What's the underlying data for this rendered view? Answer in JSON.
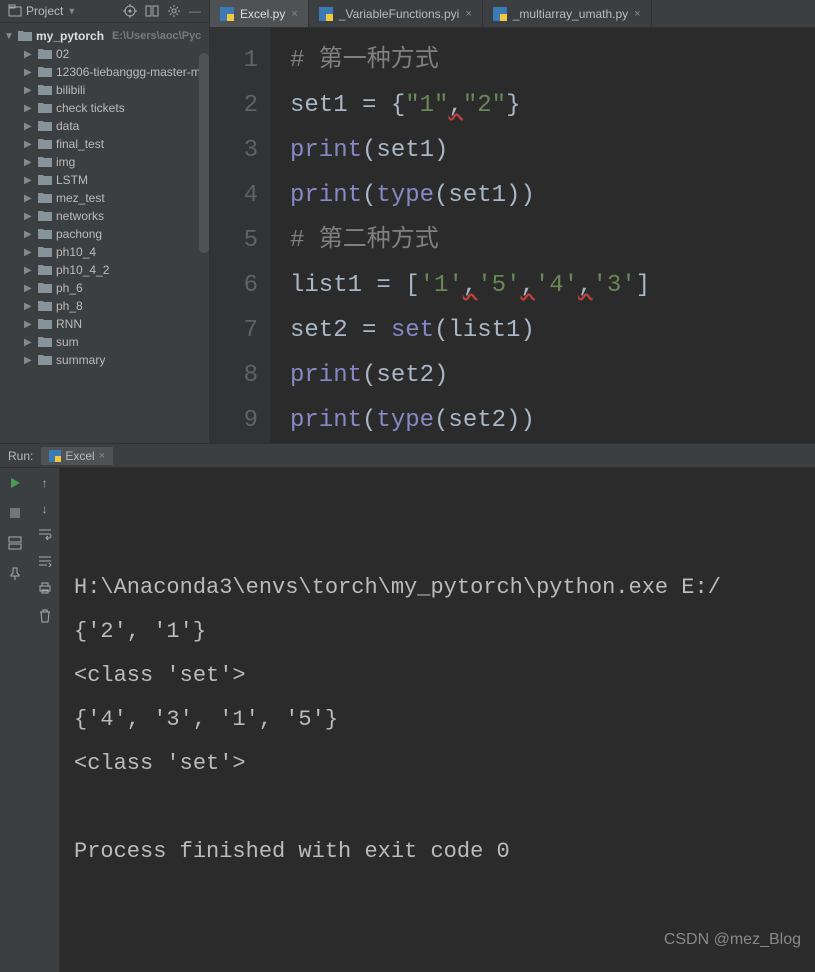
{
  "project_panel": {
    "title": "Project",
    "root_name": "my_pytorch",
    "root_path": "E:\\Users\\aoc\\Pyc",
    "folders": [
      "02",
      "12306-tiebanggg-master-m",
      "bilibili",
      "check tickets",
      "data",
      "final_test",
      "img",
      "LSTM",
      "mez_test",
      "networks",
      "pachong",
      "ph10_4",
      "ph10_4_2",
      "ph_6",
      "ph_8",
      "RNN",
      "sum",
      "summary"
    ]
  },
  "tabs": [
    {
      "label": "Excel.py",
      "active": true
    },
    {
      "label": "_VariableFunctions.pyi",
      "active": false
    },
    {
      "label": "_multiarray_umath.py",
      "active": false
    }
  ],
  "code": {
    "lines": [
      {
        "n": "1",
        "tokens": [
          {
            "t": "# 第一种方式",
            "c": "c-comment"
          }
        ]
      },
      {
        "n": "2",
        "tokens": [
          {
            "t": "set1 ",
            "c": "c-ident"
          },
          {
            "t": "= ",
            "c": "c-op"
          },
          {
            "t": "{",
            "c": "c-brace"
          },
          {
            "t": "\"1\"",
            "c": "c-string"
          },
          {
            "t": ",",
            "c": "squiggle"
          },
          {
            "t": "\"2\"",
            "c": "c-string"
          },
          {
            "t": "}",
            "c": "c-brace"
          }
        ]
      },
      {
        "n": "3",
        "tokens": [
          {
            "t": "print",
            "c": "c-builtin"
          },
          {
            "t": "(set1)",
            "c": "c-ident"
          }
        ]
      },
      {
        "n": "4",
        "tokens": [
          {
            "t": "print",
            "c": "c-builtin"
          },
          {
            "t": "(",
            "c": "c-ident"
          },
          {
            "t": "type",
            "c": "c-builtin"
          },
          {
            "t": "(set1))",
            "c": "c-ident"
          }
        ]
      },
      {
        "n": "5",
        "tokens": [
          {
            "t": "# 第二种方式",
            "c": "c-comment"
          }
        ]
      },
      {
        "n": "6",
        "tokens": [
          {
            "t": "list1 ",
            "c": "c-ident"
          },
          {
            "t": "= ",
            "c": "c-op"
          },
          {
            "t": "[",
            "c": "c-brace"
          },
          {
            "t": "'1'",
            "c": "c-string"
          },
          {
            "t": ",",
            "c": "squiggle"
          },
          {
            "t": "'5'",
            "c": "c-string"
          },
          {
            "t": ",",
            "c": "squiggle"
          },
          {
            "t": "'4'",
            "c": "c-string"
          },
          {
            "t": ",",
            "c": "squiggle"
          },
          {
            "t": "'3'",
            "c": "c-string"
          },
          {
            "t": "]",
            "c": "c-brace"
          }
        ]
      },
      {
        "n": "7",
        "tokens": [
          {
            "t": "set2 ",
            "c": "c-ident"
          },
          {
            "t": "= ",
            "c": "c-op"
          },
          {
            "t": "set",
            "c": "c-builtin"
          },
          {
            "t": "(list1)",
            "c": "c-ident"
          }
        ]
      },
      {
        "n": "8",
        "tokens": [
          {
            "t": "print",
            "c": "c-builtin"
          },
          {
            "t": "(set2)",
            "c": "c-ident"
          }
        ]
      },
      {
        "n": "9",
        "tokens": [
          {
            "t": "print",
            "c": "c-builtin"
          },
          {
            "t": "(",
            "c": "c-ident"
          },
          {
            "t": "type",
            "c": "c-builtin"
          },
          {
            "t": "(set2))",
            "c": "c-ident"
          }
        ]
      }
    ]
  },
  "run": {
    "label": "Run:",
    "tab": "Excel",
    "output": [
      "H:\\Anaconda3\\envs\\torch\\my_pytorch\\python.exe E:/",
      "{'2', '1'}",
      "<class 'set'>",
      "{'4', '3', '1', '5'}",
      "<class 'set'>",
      "",
      "Process finished with exit code 0"
    ]
  },
  "watermark": "CSDN @mez_Blog"
}
